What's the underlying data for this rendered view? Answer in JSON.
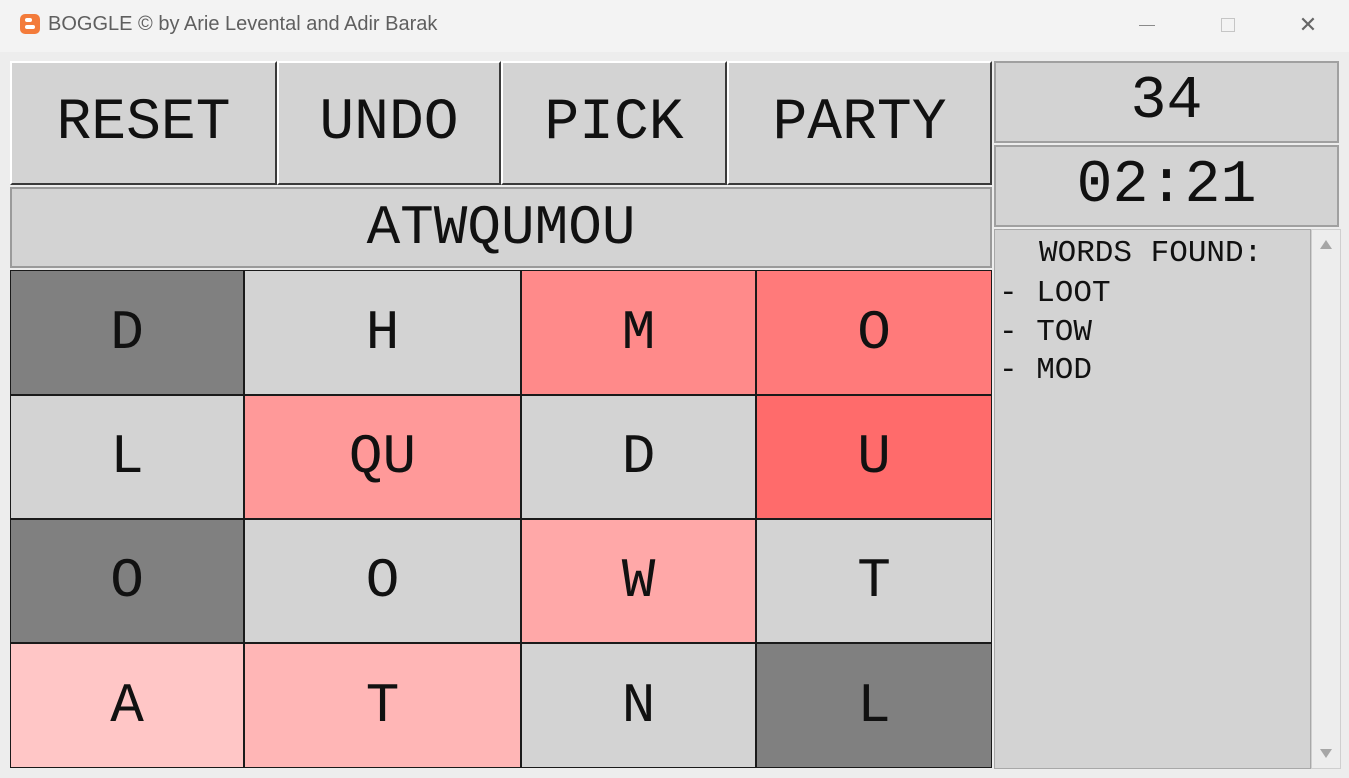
{
  "window": {
    "title": "BOGGLE © by Arie Levental and Adir Barak",
    "icon": "blogger-app-icon",
    "controls": [
      "minimize",
      "maximize",
      "close"
    ]
  },
  "toolbar": {
    "reset_label": "RESET",
    "undo_label": "UNDO",
    "pick_label": "PICK",
    "party_label": "PARTY"
  },
  "current_word": "ATWQUMOU",
  "score": "34",
  "timer": "02:21",
  "words_found": {
    "header": "WORDS FOUND:",
    "items": [
      "- LOOT",
      "- TOW",
      "- MOD"
    ]
  },
  "board": {
    "rows": [
      [
        {
          "letter": "D",
          "color": "#808080"
        },
        {
          "letter": "H",
          "color": "#d3d3d3"
        },
        {
          "letter": "M",
          "color": "#ff8a8a"
        },
        {
          "letter": "O",
          "color": "#ff7a7a"
        }
      ],
      [
        {
          "letter": "L",
          "color": "#d3d3d3"
        },
        {
          "letter": "QU",
          "color": "#ff9999"
        },
        {
          "letter": "D",
          "color": "#d3d3d3"
        },
        {
          "letter": "U",
          "color": "#ff6b6b"
        }
      ],
      [
        {
          "letter": "O",
          "color": "#808080"
        },
        {
          "letter": "O",
          "color": "#d3d3d3"
        },
        {
          "letter": "W",
          "color": "#ffa8a8"
        },
        {
          "letter": "T",
          "color": "#d3d3d3"
        }
      ],
      [
        {
          "letter": "A",
          "color": "#ffc6c6"
        },
        {
          "letter": "T",
          "color": "#ffb6b6"
        },
        {
          "letter": "N",
          "color": "#d3d3d3"
        },
        {
          "letter": "L",
          "color": "#808080"
        }
      ]
    ]
  }
}
